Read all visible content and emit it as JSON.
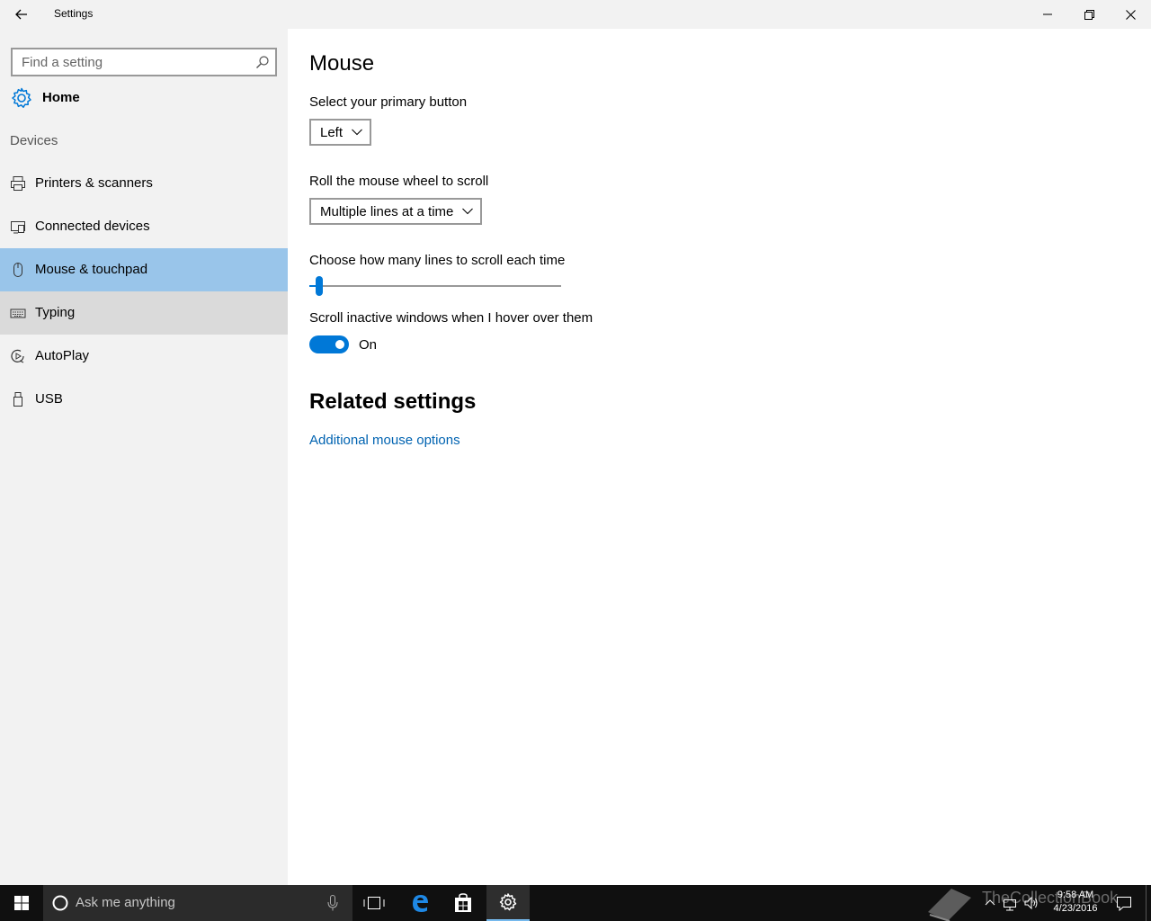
{
  "window": {
    "title": "Settings"
  },
  "sidebar": {
    "search_placeholder": "Find a setting",
    "home_label": "Home",
    "section_label": "Devices",
    "items": [
      {
        "label": "Printers & scanners",
        "icon": "printer-icon"
      },
      {
        "label": "Connected devices",
        "icon": "connected-devices-icon"
      },
      {
        "label": "Mouse & touchpad",
        "icon": "mouse-icon",
        "selected": true
      },
      {
        "label": "Typing",
        "icon": "keyboard-icon"
      },
      {
        "label": "AutoPlay",
        "icon": "autoplay-icon"
      },
      {
        "label": "USB",
        "icon": "usb-icon"
      }
    ]
  },
  "main": {
    "title": "Mouse",
    "primary_button": {
      "label": "Select your primary button",
      "value": "Left"
    },
    "wheel_scroll": {
      "label": "Roll the mouse wheel to scroll",
      "value": "Multiple lines at a time"
    },
    "lines_slider": {
      "label": "Choose how many lines to scroll each time",
      "value_fraction": 0.01
    },
    "inactive_scroll": {
      "label": "Scroll inactive windows when I hover over them",
      "state": "On"
    },
    "related": {
      "title": "Related settings",
      "link": "Additional mouse options"
    }
  },
  "taskbar": {
    "search_placeholder": "Ask me anything",
    "time": "9:58 AM",
    "date": "4/23/2016",
    "watermark": "TheCollectionBook"
  },
  "colors": {
    "accent": "#0078d7",
    "selected_nav": "#99c5ea",
    "link": "#0063b1",
    "sidebar_bg": "#f2f2f2",
    "taskbar_bg": "#101010"
  }
}
